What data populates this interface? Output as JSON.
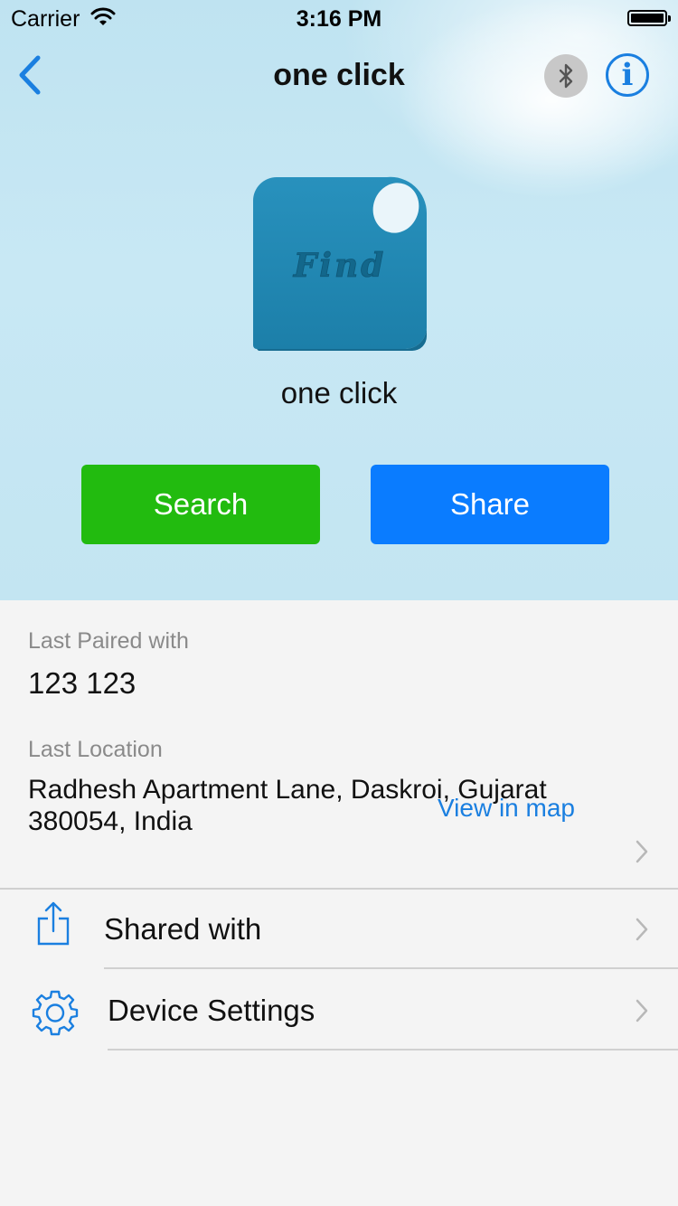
{
  "status_bar": {
    "carrier": "Carrier",
    "time": "3:16 PM"
  },
  "nav": {
    "title": "one click",
    "info_glyph": "i"
  },
  "device": {
    "tag_label": "Find",
    "name": "one click"
  },
  "actions": {
    "search_label": "Search",
    "share_label": "Share",
    "search_color": "#22bb0f",
    "share_color": "#0a7cff"
  },
  "details": {
    "last_paired_label": "Last Paired with",
    "last_paired_value": "123 123",
    "last_location_label": "Last Location",
    "address_line1": "Radhesh Apartment Lane, Daskroi, Gujarat",
    "address_line2": "380054, India",
    "view_in_map": "View in map"
  },
  "menu": [
    {
      "label": "Shared with",
      "icon": "share-icon"
    },
    {
      "label": "Device Settings",
      "icon": "gear-icon"
    }
  ],
  "colors": {
    "accent": "#1a7fe0",
    "hero_bg": "#c3e5f2",
    "tag": "#1f89b3"
  }
}
